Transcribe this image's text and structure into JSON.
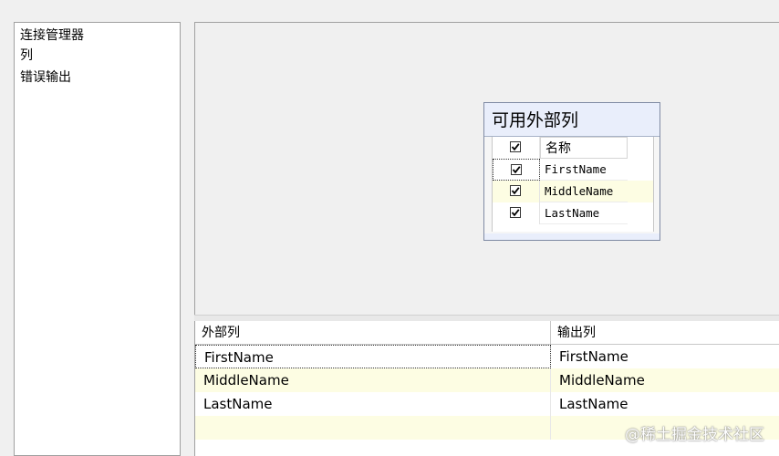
{
  "nav": {
    "items": [
      {
        "label": "连接管理器"
      },
      {
        "label": "列"
      },
      {
        "label": "错误输出"
      }
    ]
  },
  "designer": {
    "table_title": "可用外部列",
    "header": {
      "checked": true,
      "label": "名称"
    },
    "columns": [
      {
        "name": "FirstName",
        "checked": true
      },
      {
        "name": "MiddleName",
        "checked": true
      },
      {
        "name": "LastName",
        "checked": true
      }
    ]
  },
  "mapping": {
    "headers": [
      "外部列",
      "输出列"
    ],
    "rows": [
      {
        "external": "FirstName",
        "output": "FirstName"
      },
      {
        "external": "MiddleName",
        "output": "MiddleName"
      },
      {
        "external": "LastName",
        "output": "LastName"
      },
      {
        "external": "",
        "output": ""
      }
    ]
  },
  "watermark": "@稀土掘金技术社区",
  "colors": {
    "row_highlight": "#fdfde3",
    "title_bar": "#e9eefb"
  }
}
